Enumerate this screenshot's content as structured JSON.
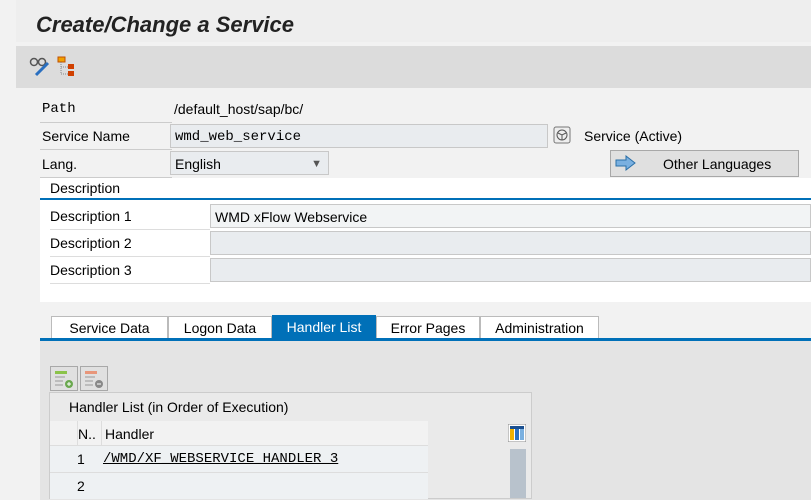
{
  "window": {
    "title": "Create/Change a Service"
  },
  "toolbar": {
    "icons": [
      "display-change-icon",
      "hierarchy-icon"
    ]
  },
  "form": {
    "path_label": "Path",
    "path_value": "/default_host/sap/bc/",
    "service_name_label": "Service Name",
    "service_name_value": "wmd_web_service",
    "service_status": "Service (Active)",
    "lang_label": "Lang.",
    "lang_value": "English",
    "other_languages": "Other Languages"
  },
  "description": {
    "title": "Description",
    "rows": [
      {
        "label": "Description 1",
        "value": "WMD xFlow Webservice"
      },
      {
        "label": "Description 2",
        "value": ""
      },
      {
        "label": "Description 3",
        "value": ""
      }
    ]
  },
  "tabs": [
    {
      "label": "Service Data",
      "active": false
    },
    {
      "label": "Logon Data",
      "active": false
    },
    {
      "label": "Handler List",
      "active": true
    },
    {
      "label": "Error Pages",
      "active": false
    },
    {
      "label": "Administration",
      "active": false
    }
  ],
  "handler_list": {
    "title": "Handler List (in Order of Execution)",
    "columns": [
      "N..",
      "Handler"
    ],
    "rows": [
      {
        "n": "1",
        "handler": "/WMD/XF_WEBSERVICE_HANDLER_3"
      },
      {
        "n": "2",
        "handler": ""
      }
    ]
  },
  "colors": {
    "accent": "#0070b8"
  }
}
